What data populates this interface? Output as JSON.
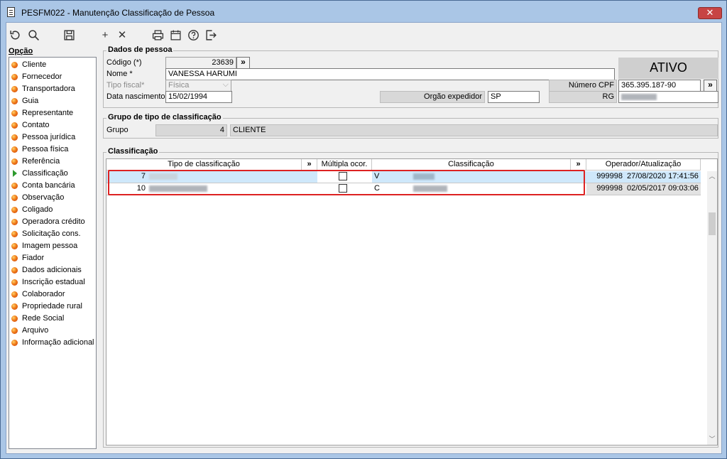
{
  "window": {
    "title": "PESFM022 - Manutenção Classificação de Pessoa",
    "close_symbol": "✕"
  },
  "toolbar": {
    "add_symbol": "+",
    "remove_symbol": "✕"
  },
  "sidebar": {
    "title": "Opção",
    "items": [
      {
        "label": "Cliente"
      },
      {
        "label": "Fornecedor"
      },
      {
        "label": "Transportadora"
      },
      {
        "label": "Guia"
      },
      {
        "label": "Representante"
      },
      {
        "label": "Contato"
      },
      {
        "label": "Pessoa jurídica"
      },
      {
        "label": "Pessoa física"
      },
      {
        "label": "Referência"
      },
      {
        "label": "Classificação"
      },
      {
        "label": "Conta bancária"
      },
      {
        "label": "Observação"
      },
      {
        "label": "Coligado"
      },
      {
        "label": "Operadora crédito"
      },
      {
        "label": "Solicitação cons."
      },
      {
        "label": "Imagem pessoa"
      },
      {
        "label": "Fiador"
      },
      {
        "label": "Dados adicionais"
      },
      {
        "label": "Inscrição estadual"
      },
      {
        "label": "Colaborador"
      },
      {
        "label": "Propriedade rural"
      },
      {
        "label": "Rede Social"
      },
      {
        "label": "Arquivo"
      },
      {
        "label": "Informação adicional"
      }
    ]
  },
  "dados": {
    "title": "Dados de pessoa",
    "codigo_label": "Código (*)",
    "codigo_value": "23639",
    "nome_label": "Nome *",
    "nome_value": "VANESSA HARUMI",
    "tipo_label": "Tipo fiscal*",
    "tipo_value": "Física",
    "nasc_label": "Data nascimento",
    "nasc_value": "15/02/1994",
    "orgao_label": "Orgão expedidor",
    "orgao_value": "SP",
    "cpf_label": "Número CPF",
    "cpf_value": "365.395.187-90",
    "rg_label": "RG",
    "status": "ATIVO",
    "expand_symbol": "»"
  },
  "grupo": {
    "title": "Grupo de tipo de classificação",
    "grupo_label": "Grupo",
    "grupo_code": "4",
    "grupo_name": "CLIENTE"
  },
  "classificacao": {
    "title": "Classificação",
    "headers": {
      "tipo": "Tipo de classificação",
      "multipla": "Múltipla ocor.",
      "classif": "Classificação",
      "operador": "Operador/Atualização",
      "expand": "»"
    },
    "rows": [
      {
        "code": "7",
        "multipla": false,
        "classif_code": "V",
        "operador": "999998",
        "atualizacao": "27/08/2020 17:41:56"
      },
      {
        "code": "10",
        "multipla": false,
        "classif_code": "C",
        "operador": "999998",
        "atualizacao": "02/05/2017 09:03:06"
      }
    ]
  }
}
